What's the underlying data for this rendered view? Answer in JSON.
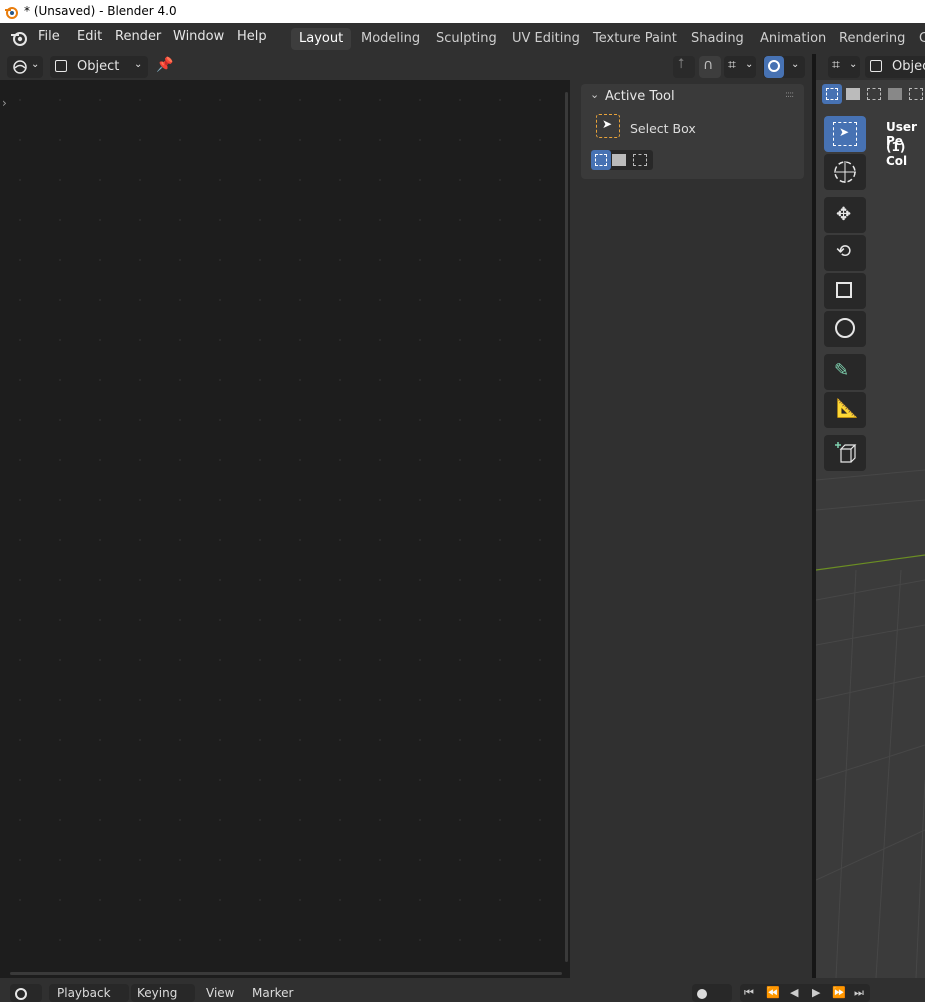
{
  "window": {
    "title": "* (Unsaved) - Blender 4.0"
  },
  "menu": {
    "file": "File",
    "edit": "Edit",
    "render": "Render",
    "window": "Window",
    "help": "Help"
  },
  "workspaces": [
    "Layout",
    "Modeling",
    "Sculpting",
    "UV Editing",
    "Texture Paint",
    "Shading",
    "Animation",
    "Rendering",
    "C"
  ],
  "editor_header": {
    "mode_value": "Object"
  },
  "active_tool_panel": {
    "title": "Active Tool",
    "tool_name": "Select Box"
  },
  "viewport": {
    "mode_value": "Objec",
    "overlay_line1": "User Pe",
    "overlay_line2": "(1) Col"
  },
  "timeline": {
    "playback": "Playback",
    "keying": "Keying",
    "view": "View",
    "marker": "Marker"
  },
  "colors": {
    "accent": "#4772b3",
    "panel": "#303030",
    "canvas": "#1d1d1d"
  }
}
